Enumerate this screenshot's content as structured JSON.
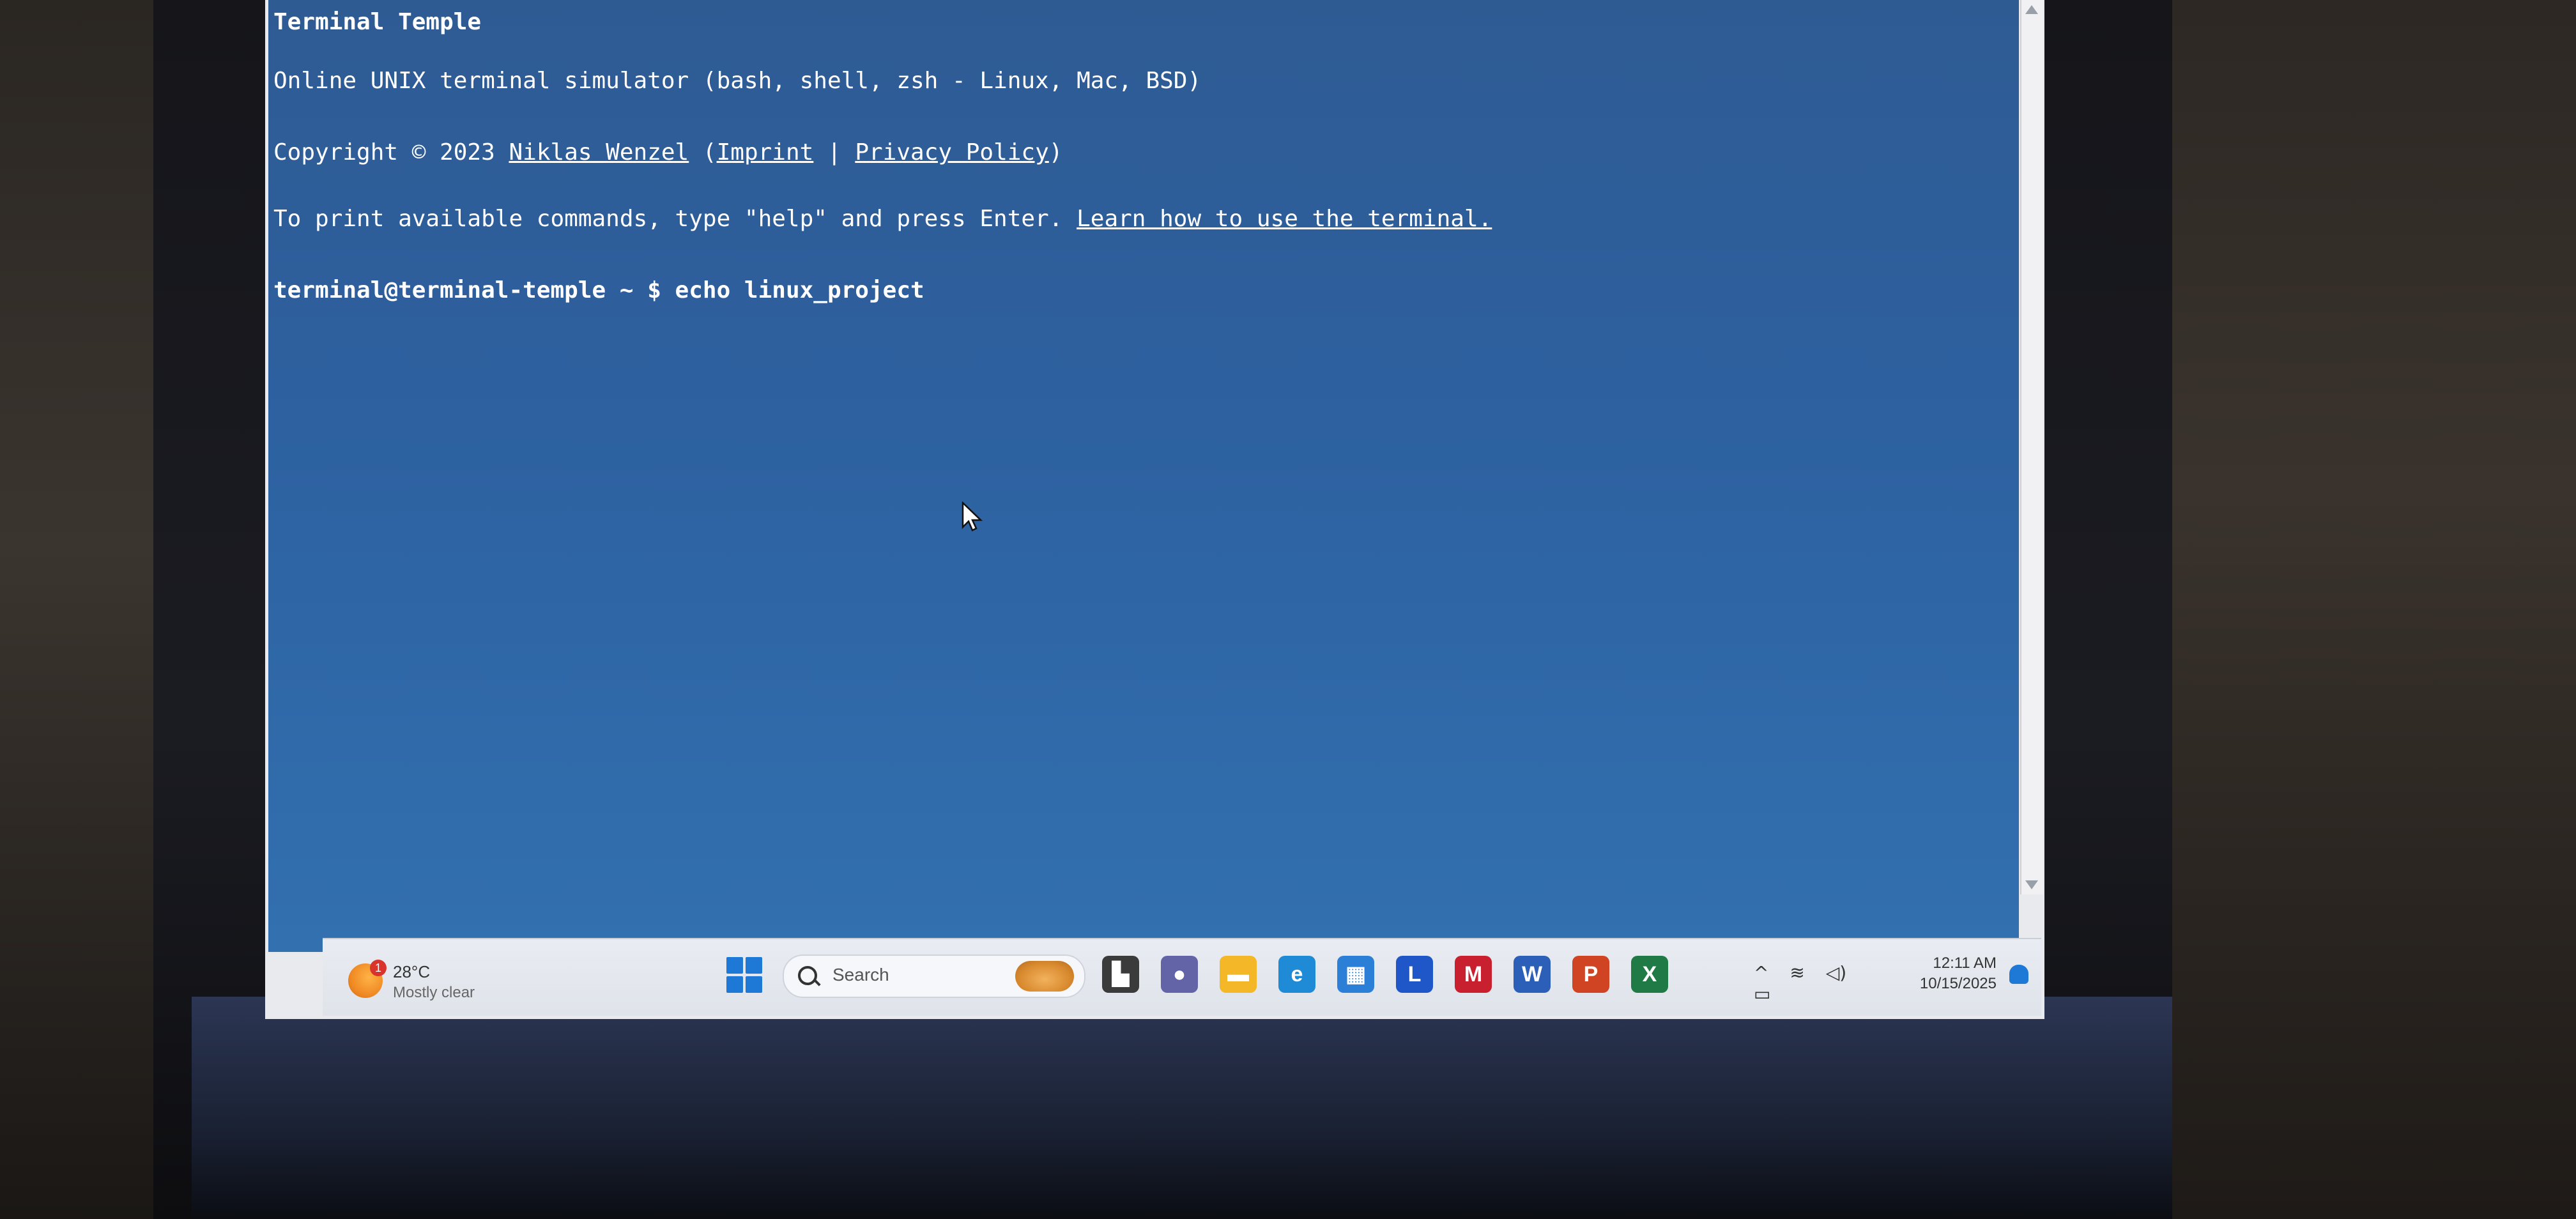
{
  "terminal": {
    "title": "Terminal Temple",
    "subtitle": "Online UNIX terminal simulator (bash, shell, zsh - Linux, Mac, BSD)",
    "copyright_prefix": "Copyright © 2023 ",
    "author_link": "Niklas Wenzel",
    "paren_open": " (",
    "imprint_link": "Imprint",
    "separator": " | ",
    "privacy_link": "Privacy Policy",
    "paren_close": ")",
    "help_text": "To print available commands, type \"help\" and press Enter. ",
    "learn_link": "Learn how to use the terminal.",
    "prompt": "terminal@terminal-temple ~ $ ",
    "command": "echo linux_project"
  },
  "taskbar": {
    "weather": {
      "temp": "28°C",
      "desc": "Mostly clear",
      "badge": "1"
    },
    "search_placeholder": "Search",
    "apps": [
      {
        "name": "task-view",
        "glyph": "▙",
        "color": "#3b3b3b"
      },
      {
        "name": "teams-chat",
        "glyph": "●",
        "color": "#6264a7"
      },
      {
        "name": "file-explorer",
        "glyph": "▬",
        "color": "#f4b728"
      },
      {
        "name": "edge",
        "glyph": "e",
        "color": "#1f8ad6"
      },
      {
        "name": "store",
        "glyph": "▦",
        "color": "#2b7fd6"
      },
      {
        "name": "l-app",
        "glyph": "L",
        "color": "#1f57c8"
      },
      {
        "name": "mcafee",
        "glyph": "M",
        "color": "#c8202f"
      },
      {
        "name": "word",
        "glyph": "W",
        "color": "#2b5fb8"
      },
      {
        "name": "powerpoint",
        "glyph": "P",
        "color": "#d04423"
      },
      {
        "name": "excel",
        "glyph": "X",
        "color": "#1f7a45"
      }
    ],
    "tray": {
      "chevron": "^",
      "wifi": "≋",
      "volume": "◁)",
      "battery": "▭"
    },
    "clock": {
      "time": "12:11 AM",
      "date": "10/15/2025"
    }
  }
}
